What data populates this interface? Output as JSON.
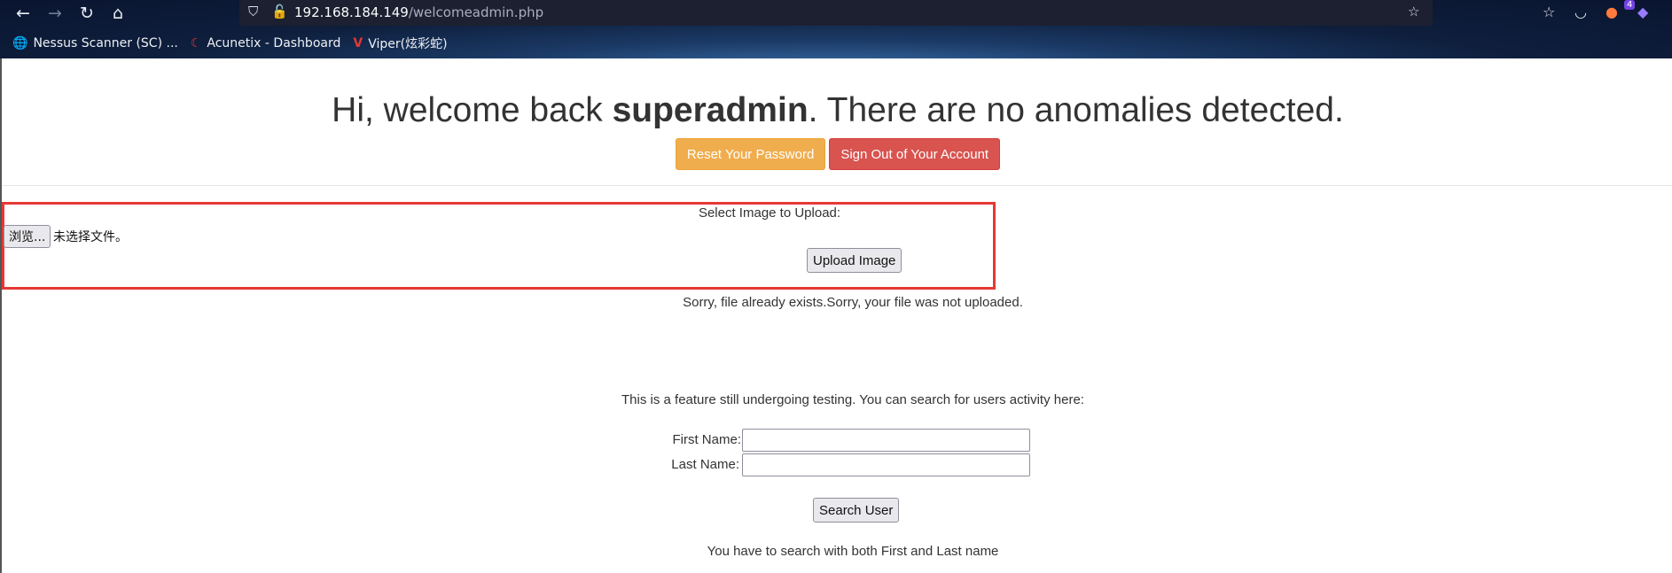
{
  "browser": {
    "url_host": "192.168.184.149",
    "url_path": "/welcomeadmin.php",
    "extension_badge": "4",
    "bookmarks": [
      {
        "label": "Nessus Scanner (SC) ...",
        "icon": "globe-icon"
      },
      {
        "label": "Acunetix - Dashboard",
        "icon": "acunetix-icon"
      },
      {
        "label": "Viper(炫彩蛇)",
        "icon": "viper-icon"
      }
    ]
  },
  "header": {
    "prefix": "Hi, welcome back ",
    "username": "superadmin",
    "suffix": ". There are no anomalies detected.",
    "reset_button": "Reset Your Password",
    "signout_button": "Sign Out of Your Account"
  },
  "upload": {
    "label": "Select Image to Upload:",
    "browse_button": "浏览...",
    "file_status": "未选择文件。",
    "submit_button": "Upload Image",
    "message": "Sorry, file already exists.Sorry, your file was not uploaded."
  },
  "search": {
    "intro": "This is a feature still undergoing testing. You can search for users activity here:",
    "first_name_label": "First Name:",
    "first_name_value": "",
    "last_name_label": "Last Name:",
    "last_name_value": "",
    "submit_button": "Search User",
    "note": "You have to search with both First and Last name"
  },
  "colors": {
    "warning": "#f0ad4e",
    "danger": "#d9534f",
    "highlight": "#e53935"
  }
}
